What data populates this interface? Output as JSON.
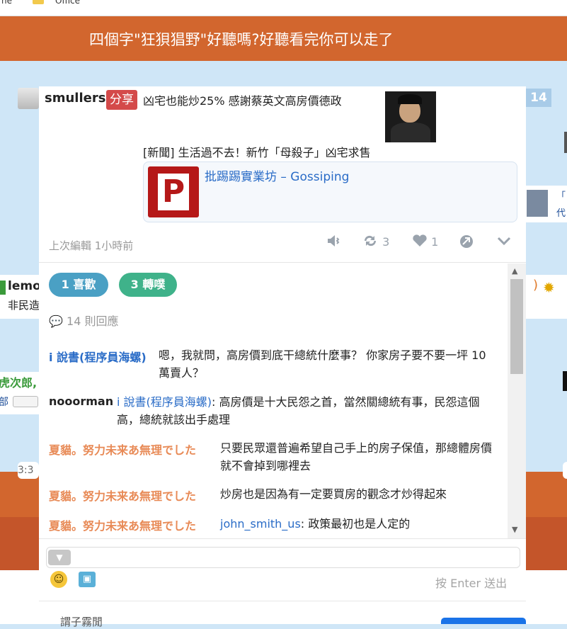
{
  "browser": {
    "bookmarks": [
      "ne",
      "Office"
    ]
  },
  "header": {
    "title": "四個字\"狂狽猖野\"好聽嗎?好聽看完你可以走了"
  },
  "background": {
    "badge_count": "14",
    "left_user": "lemo",
    "left_text": "非民造",
    "left_user2": "虎次郎,",
    "left_text2": "部",
    "right_text": "「\n代",
    "time": "3:3"
  },
  "post": {
    "user": "smullers",
    "share_label": "分享",
    "text": "凶宅也能炒25% 感謝蔡英文高房價德政",
    "news": "[新聞] 生活過不去！新竹「母殺子」凶宅求售",
    "link_logo_letter": "P",
    "link_title": "批踢踢實業坊 – Gossiping",
    "edited": "上次編輯 1小時前",
    "reshare_count": "3",
    "like_count": "1"
  },
  "comments": {
    "like_pill": "1 喜歡",
    "share_pill": "3 轉噗",
    "reply_count": "14 則回應",
    "items": [
      {
        "name": "i 說書(程序員海螺)",
        "text": "嗯，我就問，高房價到底干總統什麼事？ 你家房子要不要一坪 10 萬賣人？"
      },
      {
        "name": "nooorman",
        "mention": "i 說書(程序員海螺)",
        "text": ": 高房價是十大民怨之首，當然關總統有事，民怨這個高，總統就該出手處理"
      },
      {
        "name": "夏貓。努力未来あ無理でした",
        "text": "只要民眾還普遍希望自己手上的房子保值，那總體房價就不會掉到哪裡去"
      },
      {
        "name": "夏貓。努力未来あ無理でした",
        "text": "炒房也是因為有一定要買房的觀念才炒得起來"
      },
      {
        "name": "夏貓。努力未来あ無理でした",
        "mention": "john_smith_us",
        "text": ": 政策最初也是人定的"
      }
    ]
  },
  "composer": {
    "enter_hint": "按 Enter 送出"
  },
  "footer": {
    "text": "謂子霧閒"
  }
}
